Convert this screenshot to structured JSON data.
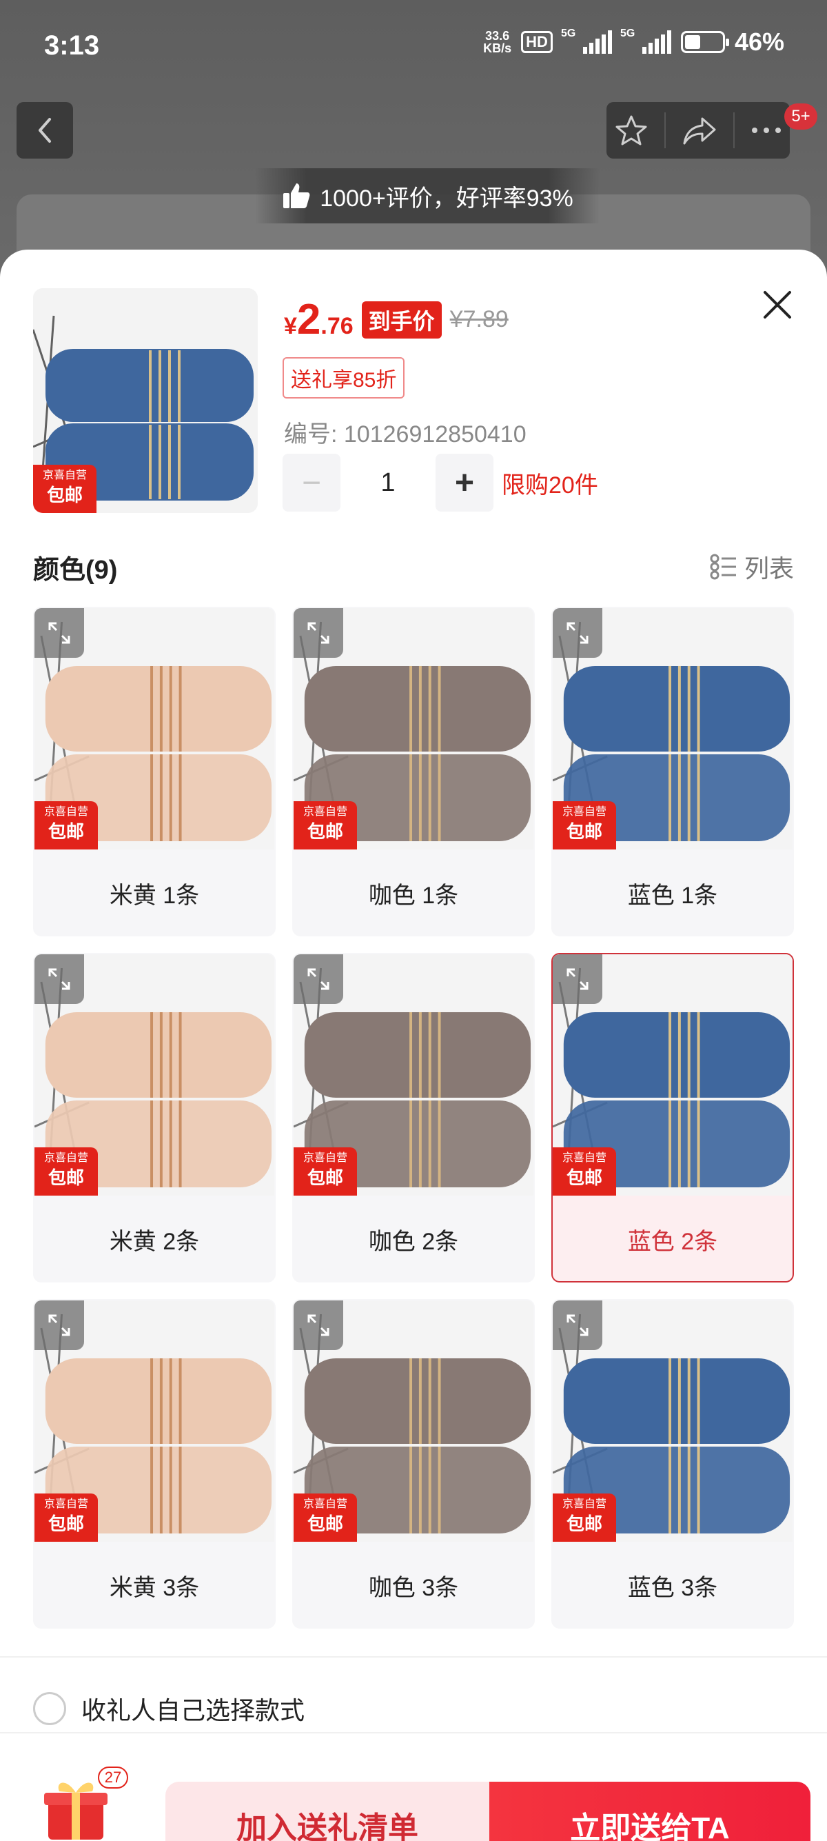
{
  "status_bar": {
    "time": "3:13",
    "net_speed_value": "33.6",
    "net_speed_unit": "KB/s",
    "hd": "HD",
    "net1": "5G",
    "net2": "5G",
    "battery": "46%"
  },
  "header": {
    "badge": "5+",
    "rating_text": "1000+评价，好评率93%"
  },
  "product": {
    "currency": "¥",
    "price_int": "2",
    "price_dec": ".76",
    "final_price_tag": "到手价",
    "original_price": "¥7.89",
    "gift_discount": "送礼享85折",
    "sku": "编号: 10126912850410",
    "quantity": "1",
    "limit": "限购20件",
    "thumb_color": "#3f679e"
  },
  "jd_badge": {
    "small": "京喜自营",
    "big": "包邮"
  },
  "colors_section": {
    "title": "颜色(9)",
    "view_label": "列表"
  },
  "options": [
    {
      "label": "米黄 1条",
      "color": "#ecc9b2",
      "stripe": "#c98f64",
      "selected": false
    },
    {
      "label": "咖色 1条",
      "color": "#887974",
      "stripe": "#d4b482",
      "selected": false
    },
    {
      "label": "蓝色 1条",
      "color": "#3f679e",
      "stripe": "#d9c089",
      "selected": false
    },
    {
      "label": "米黄 2条",
      "color": "#ecc9b2",
      "stripe": "#c98f64",
      "selected": false
    },
    {
      "label": "咖色 2条",
      "color": "#887974",
      "stripe": "#d4b482",
      "selected": false
    },
    {
      "label": "蓝色 2条",
      "color": "#3f679e",
      "stripe": "#d9c089",
      "selected": true
    },
    {
      "label": "米黄 3条",
      "color": "#ecc9b2",
      "stripe": "#c98f64",
      "selected": false
    },
    {
      "label": "咖色 3条",
      "color": "#887974",
      "stripe": "#d4b482",
      "selected": false
    },
    {
      "label": "蓝色 3条",
      "color": "#3f679e",
      "stripe": "#d9c089",
      "selected": false
    }
  ],
  "recipient_option": "收礼人自己选择款式",
  "bottom": {
    "gift_count": "27",
    "add_button": "加入送礼清单",
    "send_button": "立即送给TA"
  }
}
